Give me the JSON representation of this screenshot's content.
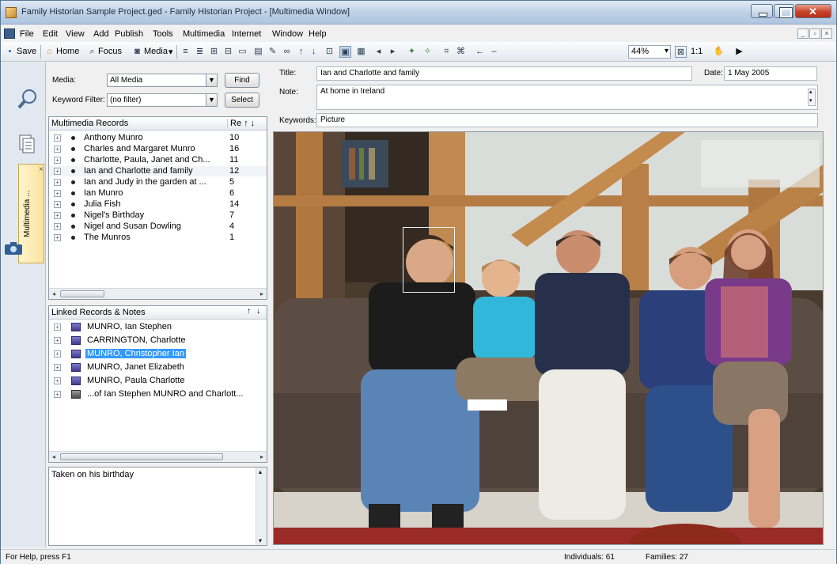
{
  "window": {
    "title": "Family Historian Sample Project.ged - Family Historian Project - [Multimedia Window]"
  },
  "menubar": {
    "items": [
      "File",
      "Edit",
      "View",
      "Add",
      "Publish",
      "Tools",
      "Multimedia",
      "Internet",
      "Window",
      "Help"
    ]
  },
  "toolbar": {
    "save_label": "Save",
    "home_label": "Home",
    "focus_label": "Focus",
    "media_label": "Media",
    "zoom_value": "44%",
    "one_to_one_label": "1:1"
  },
  "sidebar": {
    "multimedia_tab_label": "Multimedia ..."
  },
  "filters": {
    "media_label": "Media:",
    "media_value": "All Media",
    "keyword_label": "Keyword Filter:",
    "keyword_value": "(no filter)",
    "find_label": "Find",
    "select_label": "Select"
  },
  "multimedia_records": {
    "header_name": "Multimedia Records",
    "header_count": "Re",
    "rows": [
      {
        "name": "Anthony Munro",
        "count": "10"
      },
      {
        "name": "Charles and Margaret Munro",
        "count": "16"
      },
      {
        "name": "Charlotte, Paula, Janet and Ch...",
        "count": "11"
      },
      {
        "name": "Ian and Charlotte and family",
        "count": "12"
      },
      {
        "name": "Ian and Judy in the garden at ...",
        "count": "5"
      },
      {
        "name": "Ian Munro",
        "count": "6"
      },
      {
        "name": "Julia Fish",
        "count": "14"
      },
      {
        "name": "Nigel's Birthday",
        "count": "7"
      },
      {
        "name": "Nigel and Susan Dowling",
        "count": "4"
      },
      {
        "name": "The Munros",
        "count": "1"
      }
    ]
  },
  "linked_records": {
    "header": "Linked Records & Notes",
    "rows": [
      {
        "name": "MUNRO, Ian Stephen"
      },
      {
        "name": "CARRINGTON, Charlotte"
      },
      {
        "name": "MUNRO, Christopher Ian"
      },
      {
        "name": "MUNRO, Janet Elizabeth"
      },
      {
        "name": "MUNRO, Paula Charlotte"
      },
      {
        "name": "...of Ian Stephen MUNRO and Charlott..."
      }
    ],
    "selected_index": 2
  },
  "note_panel": {
    "text": "Taken on his birthday"
  },
  "details": {
    "title_label": "Title:",
    "title_value": "Ian and Charlotte and family",
    "date_label": "Date:",
    "date_value": "1 May 2005",
    "note_label": "Note:",
    "note_value": "At home in Ireland",
    "keywords_label": "Keywords:",
    "keywords_value": "Picture"
  },
  "statusbar": {
    "help_text": "For Help, press F1",
    "individuals": "Individuals: 61",
    "families": "Families: 27"
  },
  "colors": {
    "selection": "#3399ff",
    "titlebar": "#bcd0e6",
    "close_button": "#c7432a"
  }
}
